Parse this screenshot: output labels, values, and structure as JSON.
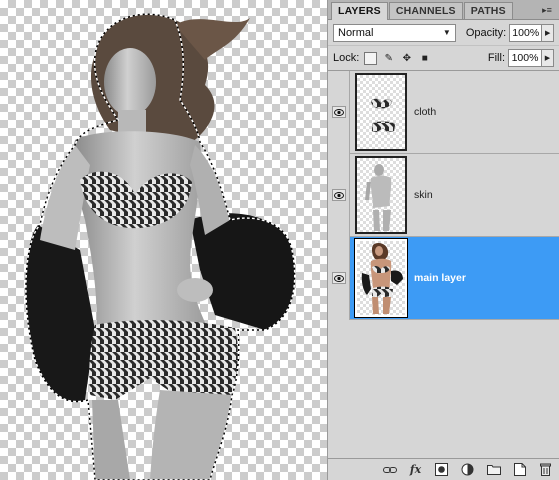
{
  "tabs": [
    {
      "label": "LAYERS",
      "active": true
    },
    {
      "label": "CHANNELS",
      "active": false
    },
    {
      "label": "PATHS",
      "active": false
    }
  ],
  "blend_mode": "Normal",
  "opacity": {
    "label": "Opacity:",
    "value": "100%"
  },
  "lock_label": "Lock:",
  "fill": {
    "label": "Fill:",
    "value": "100%"
  },
  "layers": [
    {
      "name": "cloth",
      "selected": false
    },
    {
      "name": "skin",
      "selected": false
    },
    {
      "name": "main layer",
      "selected": true
    }
  ],
  "icons": {
    "visibility": "eye-icon",
    "link": "link-icon",
    "fx": "fx",
    "mask": "layer-mask-icon",
    "adjustment": "adjustment-layer-icon",
    "group": "folder-icon",
    "new_layer": "new-layer-icon",
    "delete": "trash-icon"
  },
  "colors": {
    "selection_highlight": "#3d9bf5",
    "panel_bg": "#d6d6d6"
  }
}
